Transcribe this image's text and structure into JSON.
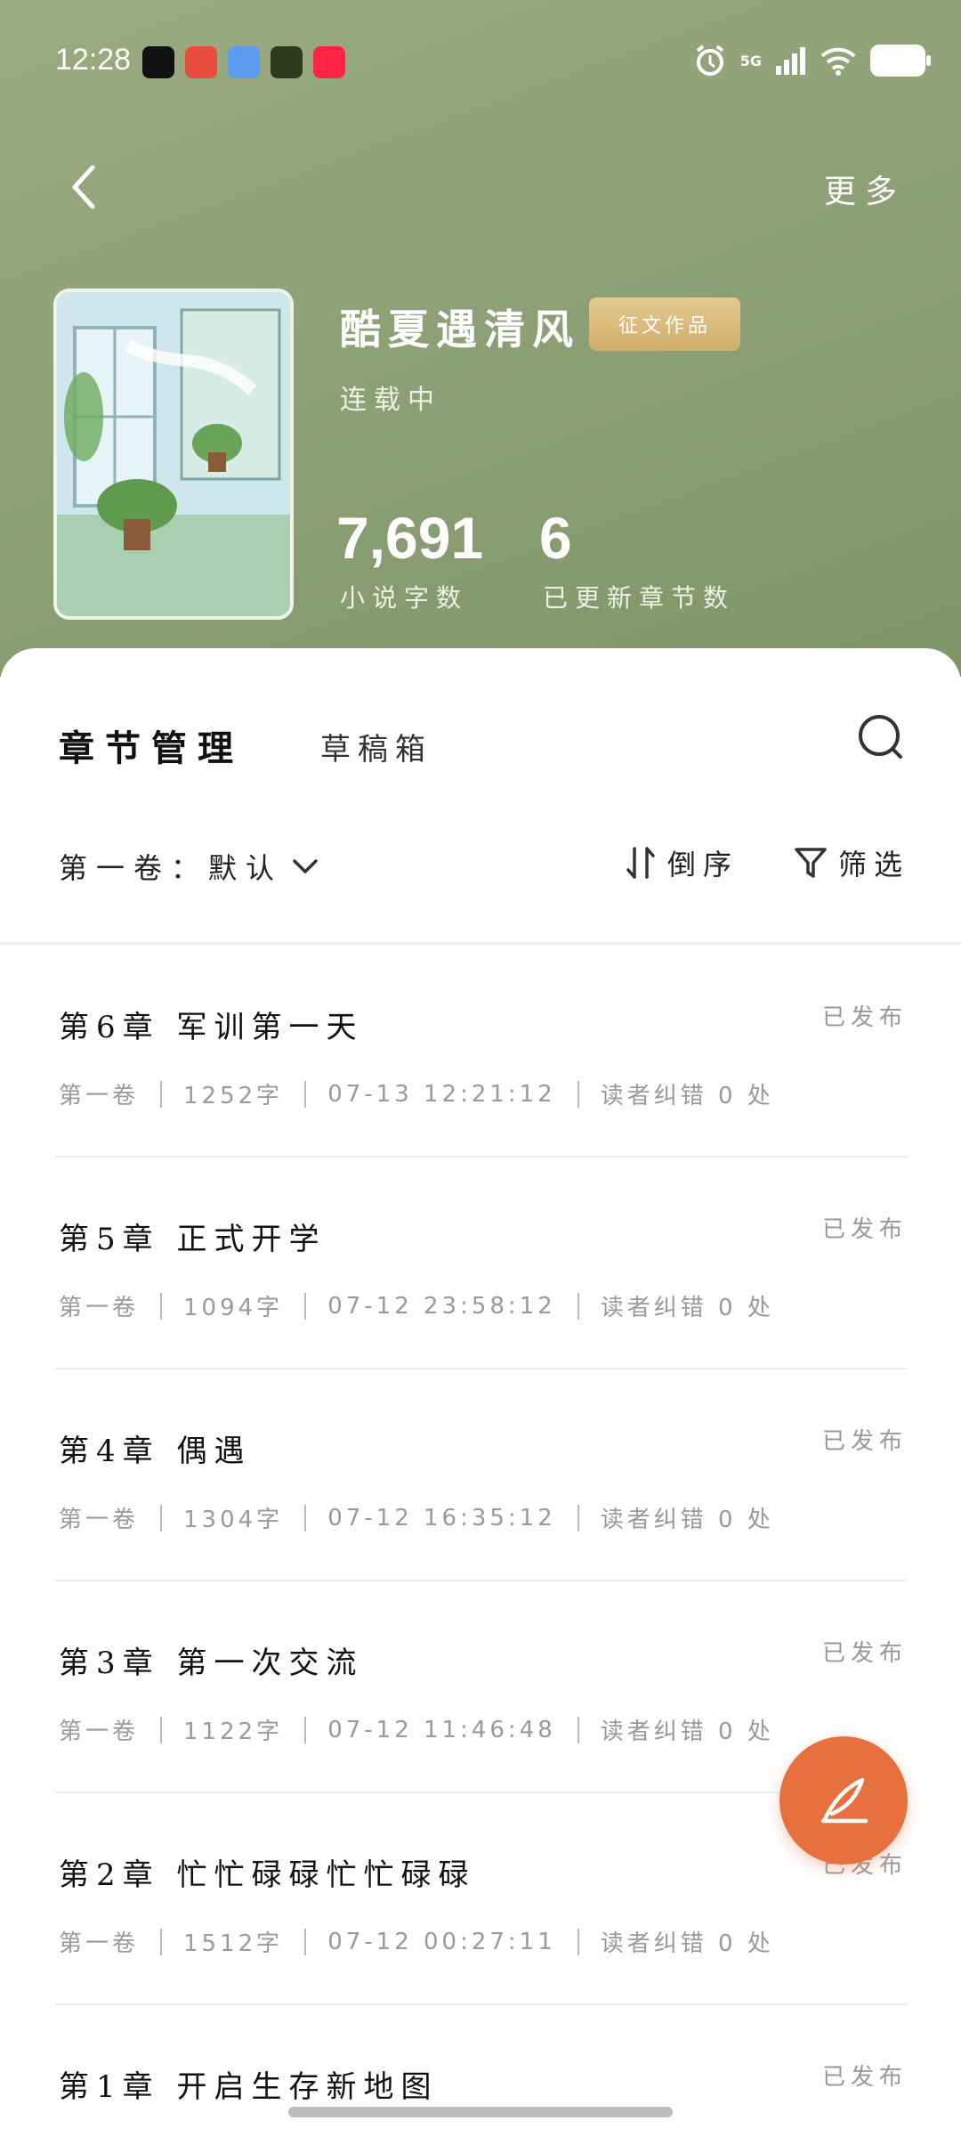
{
  "status_bar": {
    "time": "12:28",
    "network": "5G",
    "notification_icons": [
      {
        "name": "douyin-icon",
        "color": "#111111"
      },
      {
        "name": "app-red-icon",
        "color": "#e94b3c"
      },
      {
        "name": "app-blue-icon",
        "color": "#5a9cf0"
      },
      {
        "name": "app-green-icon",
        "color": "#2f3a1c"
      },
      {
        "name": "xiaohongshu-icon",
        "color": "#ff2442"
      }
    ]
  },
  "nav": {
    "more_label": "更多"
  },
  "book": {
    "title": "酷夏遇清风",
    "badge": "征文作品",
    "status": "连载中",
    "word_count": "7,691",
    "word_count_label": "小说字数",
    "chapter_count": "6",
    "chapter_count_label": "已更新章节数"
  },
  "tabs": {
    "active": "章节管理",
    "other": "草稿箱"
  },
  "filters": {
    "volume": "第一卷：默认",
    "sort": "倒序",
    "filter": "筛选"
  },
  "chapters": [
    {
      "title": "第6章 军训第一天",
      "state": "已发布",
      "volume": "第一卷",
      "words": "1252字",
      "time": "07-13 12:21:12",
      "errata": "读者纠错 0 处"
    },
    {
      "title": "第5章 正式开学",
      "state": "已发布",
      "volume": "第一卷",
      "words": "1094字",
      "time": "07-12 23:58:12",
      "errata": "读者纠错 0 处"
    },
    {
      "title": "第4章 偶遇",
      "state": "已发布",
      "volume": "第一卷",
      "words": "1304字",
      "time": "07-12 16:35:12",
      "errata": "读者纠错 0 处"
    },
    {
      "title": "第3章 第一次交流",
      "state": "已发布",
      "volume": "第一卷",
      "words": "1122字",
      "time": "07-12 11:46:48",
      "errata": "读者纠错 0 处"
    },
    {
      "title": "第2章 忙忙碌碌忙忙碌碌",
      "state": "已发布",
      "volume": "第一卷",
      "words": "1512字",
      "time": "07-12 00:27:11",
      "errata": "读者纠错 0 处"
    },
    {
      "title": "第1章 开启生存新地图",
      "state": "已发布"
    }
  ],
  "colors": {
    "header_green": "#8ea177",
    "badge_gold": "#d9bb7c",
    "fab_orange": "#e8703e"
  }
}
